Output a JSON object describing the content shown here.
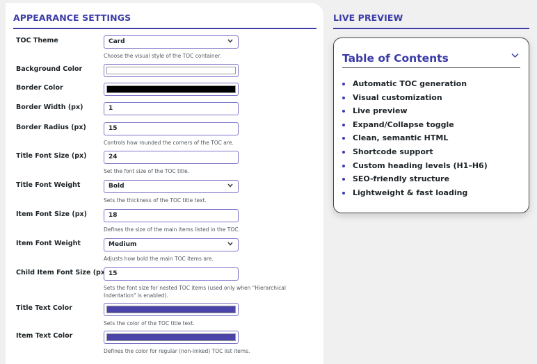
{
  "settings": {
    "title": "APPEARANCE SETTINGS",
    "fields": [
      {
        "label": "TOC Theme",
        "type": "select",
        "value": "Card",
        "desc": "Choose the visual style of the TOC container."
      },
      {
        "label": "Background Color",
        "type": "color",
        "value": "#ffffff"
      },
      {
        "label": "Border Color",
        "type": "color",
        "value": "#000000"
      },
      {
        "label": "Border Width (px)",
        "type": "number",
        "value": "1"
      },
      {
        "label": "Border Radius (px)",
        "type": "number",
        "value": "15",
        "desc": "Controls how rounded the corners of the TOC are."
      },
      {
        "label": "Title Font Size (px)",
        "type": "number",
        "value": "24",
        "desc": "Set the font size of the TOC title."
      },
      {
        "label": "Title Font Weight",
        "type": "select",
        "value": "Bold",
        "desc": "Sets the thickness of the TOC title text."
      },
      {
        "label": "Item Font Size (px)",
        "type": "number",
        "value": "18",
        "desc": "Defines the size of the main items listed in the TOC."
      },
      {
        "label": "Item Font Weight",
        "type": "select",
        "value": "Medium",
        "desc": "Adjusts how bold the main TOC items are."
      },
      {
        "label": "Child Item Font Size (px)",
        "type": "number",
        "value": "15",
        "desc": "Sets the font size for nested TOC items (used only when \"Hierarchical Indentation\" is enabled)."
      },
      {
        "label": "Title Text Color",
        "type": "color",
        "value": "#4a44a8",
        "desc": "Sets the color of the TOC title text."
      },
      {
        "label": "Item Text Color",
        "type": "color",
        "value": "#4a44a8",
        "desc": "Defines the color for regular (non-linked) TOC list items."
      }
    ]
  },
  "preview": {
    "title": "LIVE PREVIEW",
    "toc_title": "Table of Contents",
    "toggle_icon": "chevron-down",
    "items": [
      "Automatic TOC generation",
      "Visual customization",
      "Live preview",
      "Expand/Collapse toggle",
      "Clean, semantic HTML",
      "Shortcode support",
      "Custom heading levels (H1–H6)",
      "SEO-friendly structure",
      "Lightweight & fast loading"
    ]
  },
  "colors": {
    "accent": "#3b3ba8"
  }
}
